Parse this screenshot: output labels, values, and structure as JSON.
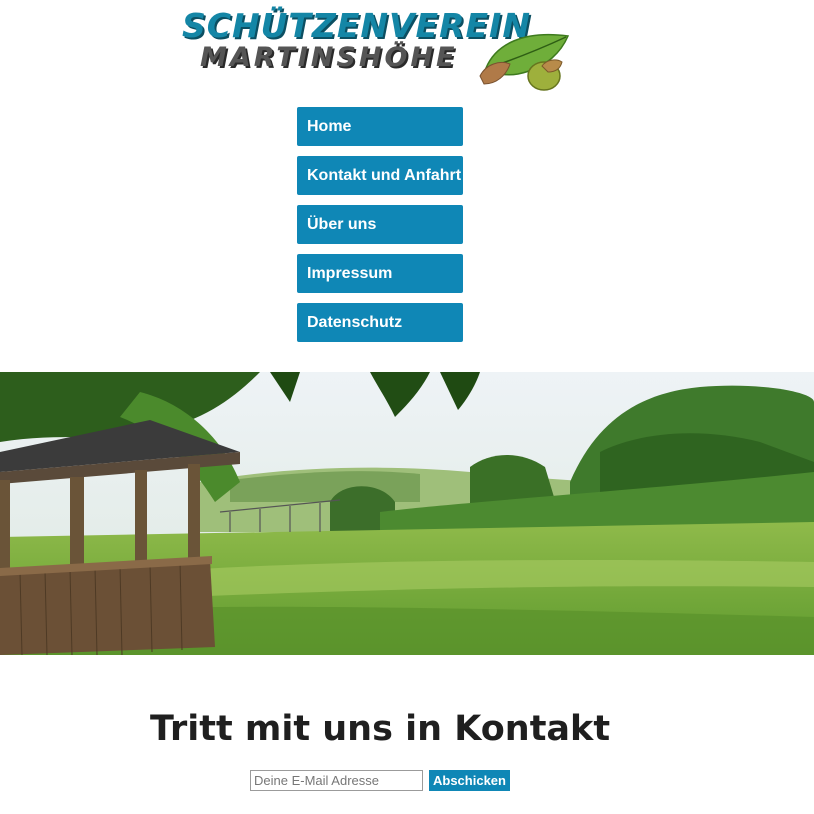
{
  "logo": {
    "line1": "SCHÜTZENVEREIN",
    "line2": "MARTINSHÖHE"
  },
  "nav": {
    "items": [
      {
        "label": "Home"
      },
      {
        "label": "Kontakt und Anfahrt"
      },
      {
        "label": "Über uns"
      },
      {
        "label": "Impressum"
      },
      {
        "label": "Datenschutz"
      }
    ]
  },
  "hero": {
    "icon": "landscape-photo"
  },
  "contact": {
    "heading": "Tritt mit uns in Kontakt",
    "email_placeholder": "Deine E-Mail Adresse",
    "submit_label": "Abschicken"
  },
  "colors": {
    "accent": "#0f87b6",
    "logo_blue": "#1486a6",
    "logo_gray": "#555555"
  }
}
